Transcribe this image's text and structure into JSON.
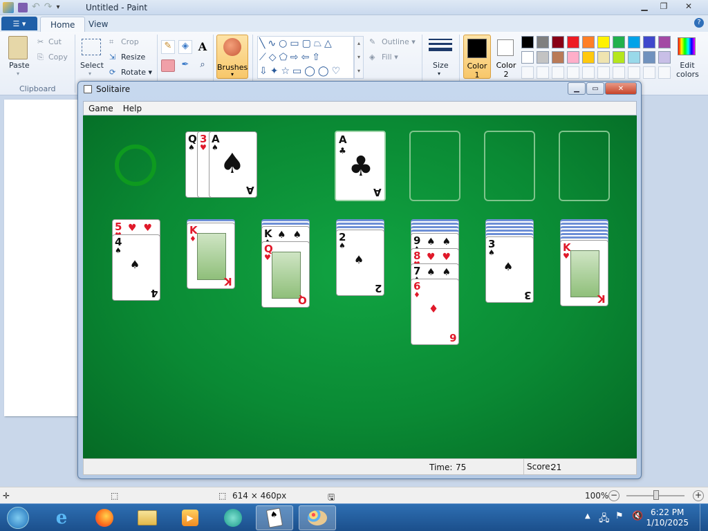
{
  "paint": {
    "title": "Untitled - Paint",
    "tabs": {
      "file": "☰ ▾",
      "home": "Home",
      "view": "View"
    },
    "clipboard": {
      "paste": "Paste",
      "cut": "Cut",
      "copy": "Copy",
      "group": "Clipboard"
    },
    "image": {
      "select": "Select",
      "crop": "Crop",
      "resize": "Resize",
      "rotate": "Rotate ▾"
    },
    "brushes": "Brushes",
    "shapes": {
      "outline": "Outline ▾",
      "fill": "Fill ▾"
    },
    "size": "Size",
    "color1": "Color 1",
    "color2": "Color 2",
    "edit_colors": "Edit colors",
    "palette_row1": [
      "#000000",
      "#7f7f7f",
      "#880015",
      "#ed1c24",
      "#ff7f27",
      "#fff200",
      "#22b14c",
      "#00a2e8",
      "#3f48cc",
      "#a349a4"
    ],
    "palette_row2": [
      "#ffffff",
      "#c3c3c3",
      "#b97a57",
      "#ffaec9",
      "#ffc90e",
      "#efe4b0",
      "#b5e61d",
      "#99d9ea",
      "#7092be",
      "#c8bfe7"
    ],
    "status": {
      "dimensions": "614 × 460px",
      "zoom": "100%"
    }
  },
  "solitaire": {
    "title": "Solitaire",
    "menu": [
      "Game",
      "Help"
    ],
    "stock_empty_icon": "recycle-circle-icon",
    "waste": [
      {
        "rank": "Q",
        "suit": "♠",
        "color": "blk"
      },
      {
        "rank": "3",
        "suit": "♥",
        "color": "red"
      },
      {
        "rank": "A",
        "suit": "♠",
        "color": "blk"
      }
    ],
    "foundation_1": {
      "rank": "A",
      "suit": "♣"
    },
    "tableau": [
      {
        "faceup": [
          {
            "rank": "5",
            "suit": "♥",
            "color": "red"
          },
          {
            "rank": "4",
            "suit": "♠",
            "color": "blk"
          }
        ]
      },
      {
        "faceup": [
          {
            "rank": "K",
            "suit": "♦",
            "color": "red"
          }
        ]
      },
      {
        "faceup": [
          {
            "rank": "K",
            "suit": "♠",
            "color": "blk"
          },
          {
            "rank": "Q",
            "suit": "♥",
            "color": "red"
          }
        ]
      },
      {
        "faceup": [
          {
            "rank": "2",
            "suit": "♠",
            "color": "blk"
          }
        ]
      },
      {
        "faceup": [
          {
            "rank": "9",
            "suit": "♠",
            "color": "blk"
          },
          {
            "rank": "8",
            "suit": "♥",
            "color": "red"
          },
          {
            "rank": "7",
            "suit": "♠",
            "color": "blk"
          },
          {
            "rank": "6",
            "suit": "♦",
            "color": "red"
          }
        ]
      },
      {
        "faceup": [
          {
            "rank": "3",
            "suit": "♠",
            "color": "blk"
          }
        ]
      },
      {
        "faceup": [
          {
            "rank": "K",
            "suit": "♥",
            "color": "red"
          }
        ]
      }
    ],
    "status": {
      "time_label": "Time:",
      "time": "75",
      "score_label": "Score:",
      "score": "21"
    }
  },
  "taskbar": {
    "time": "6:22 PM",
    "date": "1/10/2025",
    "apps": [
      "start-orb",
      "internet-explorer",
      "firefox",
      "file-explorer",
      "media-player",
      "live-messenger",
      "solitaire",
      "paint"
    ]
  }
}
